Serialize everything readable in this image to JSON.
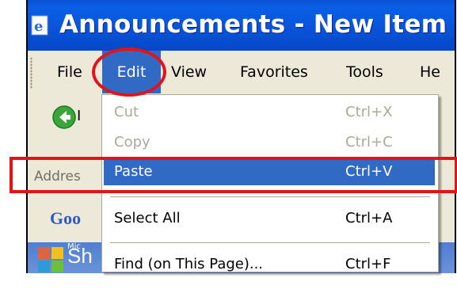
{
  "window": {
    "title": "Announcements - New Item"
  },
  "menubar": {
    "items": [
      {
        "label": "File"
      },
      {
        "label": "Edit"
      },
      {
        "label": "View"
      },
      {
        "label": "Favorites"
      },
      {
        "label": "Tools"
      },
      {
        "label": "He"
      }
    ]
  },
  "toolbar": {
    "back_label_partial": "I",
    "address_label_partial": "Addres"
  },
  "googlebar": {
    "logo_partial": "Goo"
  },
  "sharepoint": {
    "small_text": "Mic",
    "text": "Sh"
  },
  "edit_menu": {
    "items": [
      {
        "label": "Cut",
        "shortcut": "Ctrl+X",
        "enabled": false
      },
      {
        "label": "Copy",
        "shortcut": "Ctrl+C",
        "enabled": false
      },
      {
        "label": "Paste",
        "shortcut": "Ctrl+V",
        "enabled": true,
        "highlighted": true
      },
      {
        "label": "Select All",
        "shortcut": "Ctrl+A",
        "enabled": true
      },
      {
        "label": "Find (on This Page)...",
        "shortcut": "Ctrl+F",
        "enabled": true
      }
    ]
  },
  "colors": {
    "selection": "#316ac5",
    "title_bar": "#0a55dc",
    "annotation": "#e2141a",
    "disabled_text": "#aca899",
    "chrome": "#ece9d8"
  }
}
